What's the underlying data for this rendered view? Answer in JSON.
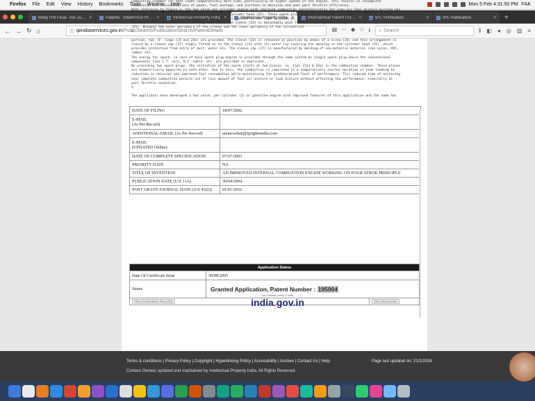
{
  "menubar": {
    "app": "Firefox",
    "items": [
      "File",
      "Edit",
      "View",
      "History",
      "Bookmarks",
      "Tools",
      "Window",
      "Help"
    ],
    "clock": "Mon 5 Feb 4:31:50 PM",
    "user": "FAK"
  },
  "tabs": [
    {
      "title": "Bibliji IYB Final- The Judgeme",
      "active": false
    },
    {
      "title": "Patents : Intellectual Property",
      "active": false
    },
    {
      "title": "Intellectual Property India",
      "active": false
    },
    {
      "title": "Intellectual Property India",
      "active": true
    },
    {
      "title": "International Patent Classificati",
      "active": false
    },
    {
      "title": "IPC Publication",
      "active": false
    },
    {
      "title": "IPC Publication",
      "active": false
    }
  ],
  "address": {
    "host": "ipindiaservices.gov.in",
    "path": "/PublicSearch/PublicationSearch/PatentDetails",
    "search_placeholder": "Search"
  },
  "abstract_text": "combustion chamber (9) that leads comparatively more time, particularly at higher speeds of the engine. This results in incomplete\ncombustion and consequent loss of power, fuel wastage, and increase in emission and poor part throttle efficiency.\nWith reference to figure 3, the two valve per cylinder engine with improved combustion characteristics for lean air fuel mixture burning has\ntwo spark plugs (21 & 22) which are located in the cylinder head (25). These spark plugs are located in the cylinder head (25) diametrically\nopposite to each other. One of the spark plug (21) is located in the same location as in the prior art and the other spark plug (22) is\nlocated on the same side as the timing chain (5). The sleeve (23) is detachably push fitted in the cylindrical portion of the cylinder head\n(25). Between the outer periphery of the sleeve and the inner periphery of the cylindrical\n$\n\nportion, two 'O' rings (24 and 24a) are provided. The sleeve (23) is retained in position by means of a screw (26) and this arrangement is\nclosed by a sleeve cap (27) snugly fitted on to the sleeve (23) with its outer lip covering the opening in the cylinder head (25), which\nprovides protection from entry of dust, water etc. The sleeve cap (27) is manufactured by molding of non-metallic material like nylon, PVC,\nrubber etc.\nThe energy for spark, in case of twin spark plug engine is provided through the same system as single spark plug where the conventional\ncomponents like C.T. coil, H.T. cable, etc. are provided in duplicate.\nBy providing two spark plugs, the initiation of the spark starts at two places, ie. tips (21a & 22a) in the combustion chamber. These places\nare diametrically opposite to each other. Due to this, the combustion is completed in a comparatively shorter duration of time leading to\nreduction in emission and improved fuel consumption while maintaining the predetermined level of performance. This reduced time of achieving\nnear complete combustion permits use of less amount of fuel air mixture or lean mixture without affecting the performance, especially at\npart throttle condition.\n$\n\nThe applicants have developed a two valve, per cylinder (2) or gasoline engine with improved features of this application and the same has",
  "details": [
    {
      "label": "DATE OF FILING",
      "value": "18/07/2002",
      "tall": false
    },
    {
      "label": "E-MAIL\n(As Per Record)",
      "value": "",
      "tall": true
    },
    {
      "label": "ADDITIONAL-EMAIL (As Per Record)",
      "value": "anuncoohan@iprightsindia.com",
      "tall": false
    },
    {
      "label": "E-MAIL\n(UPDATED Online)",
      "value": "",
      "tall": true
    },
    {
      "label": "DATE OF COMPLETE SPECIFICATION",
      "value": "07/07/2003",
      "tall": false
    },
    {
      "label": "PRIORITY DATE",
      "value": "NA",
      "tall": false
    },
    {
      "label": "TITLE OF INVENTION",
      "value": "AN IMPROVED INTERNAL COMBUSTION ENGINE WORKING ON FOUR STROK PRINCIPLE",
      "tall": false
    },
    {
      "label": "PUBLICATION DATE (U/S 11A)",
      "value": "30/04/2004",
      "tall": false
    },
    {
      "label": "POST GRANT JOURNAL DATE (U/S 43(2))",
      "value": "01/01/2010",
      "tall": false
    }
  ],
  "status": {
    "heading": "Application Status",
    "certificate_label": "Date Of Certificate Issue",
    "certificate_date": "30/08/2005",
    "status_label": "Status",
    "granted_text": "Granted Application, Patent Number :",
    "patent_number": "195904",
    "view_exam_button": "View Examination Report(s)",
    "view_docs_button": "View Documents"
  },
  "logo": {
    "tagline": "the national portal of india",
    "text_main": "india",
    "text_dot": ".",
    "text_end": "gov.in"
  },
  "footer": {
    "links": "Terms & conditions | Privacy Policy | Copyright | Hyperlinking Policy | Accessibility | Archive | Contact Us | Help",
    "owned": "Content Owned, updated and maintained by Intellectual Property India, All Rights Reserved.",
    "updated": "Page last updated on: 21/1/2016"
  },
  "colors": {
    "footer_bg": "#3a3a3a",
    "status_header_bg": "#1b1b1b",
    "dock_bg": "#2a3f62",
    "logo_blue": "#1d2b7a"
  }
}
